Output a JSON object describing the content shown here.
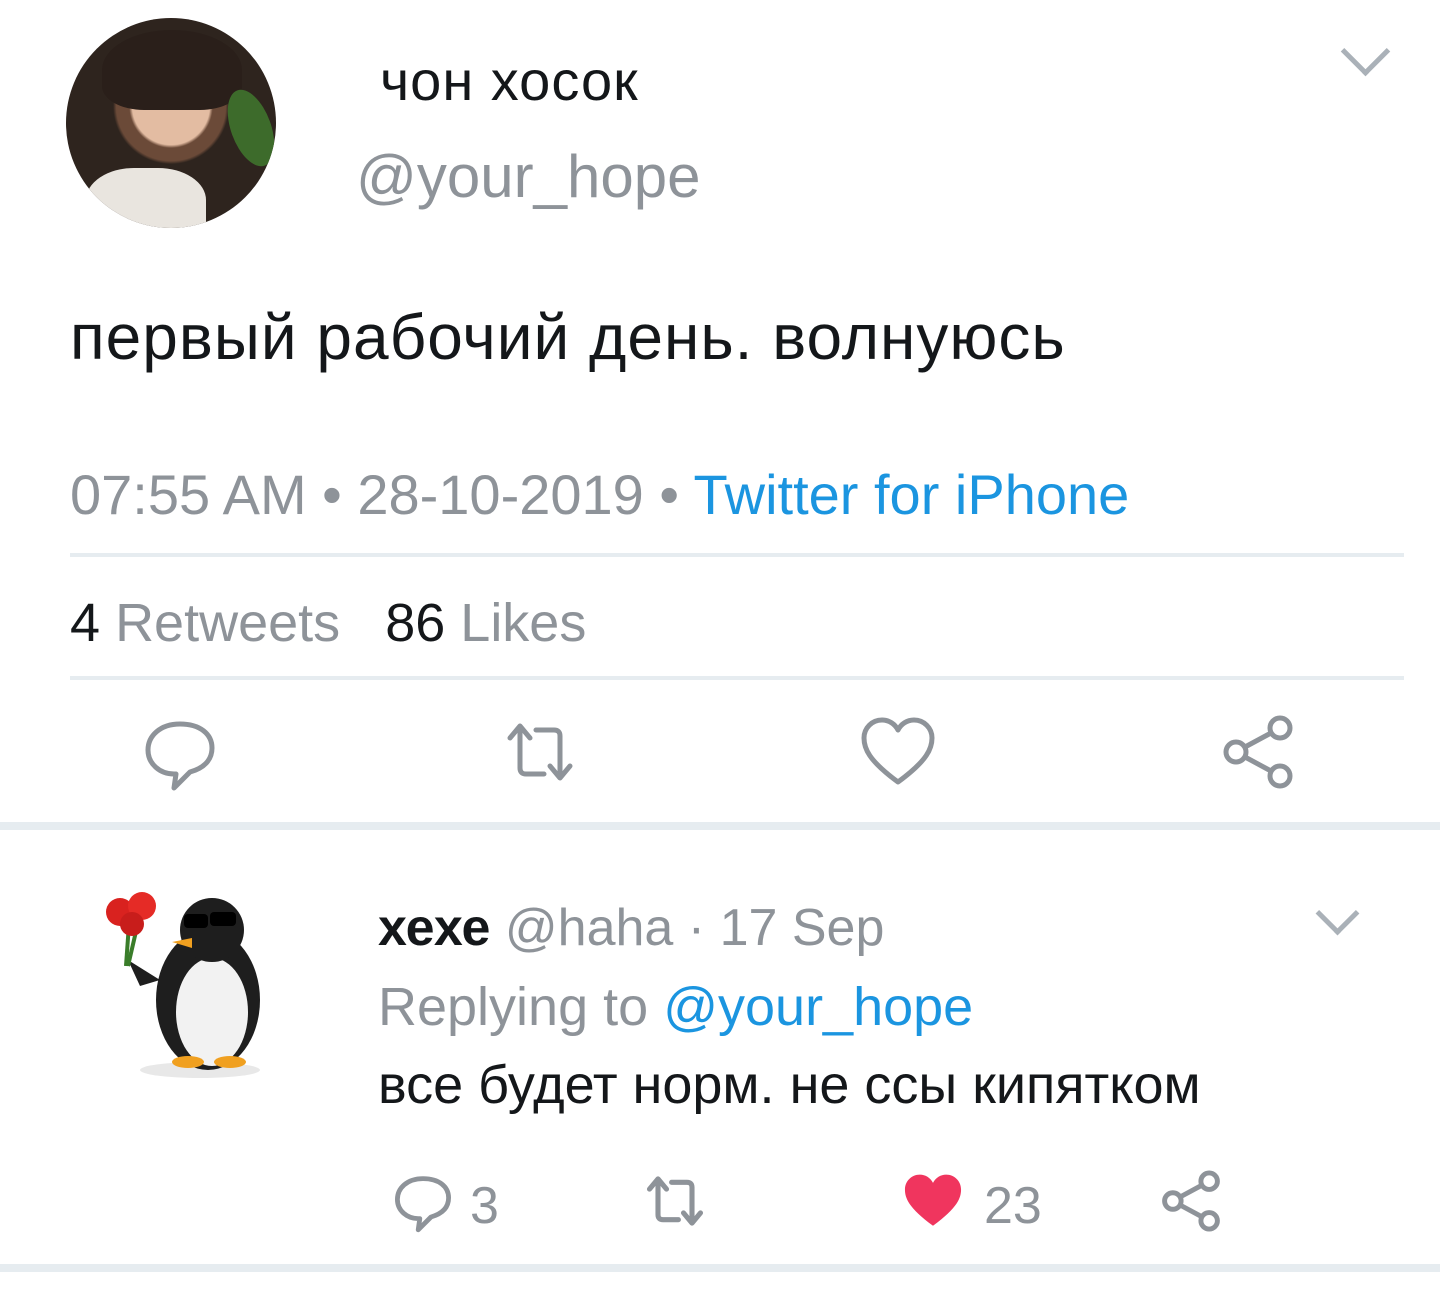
{
  "main_tweet": {
    "display_name": "чон хосок",
    "handle": "@your_hope",
    "text": "первый рабочий день. волнуюсь",
    "time": "07:55 AM",
    "separator": "•",
    "date": "28-10-2019",
    "source": "Twitter for iPhone",
    "retweets_count": "4",
    "retweets_label": "Retweets",
    "likes_count": "86",
    "likes_label": "Likes",
    "icons": [
      "reply-icon",
      "retweet-icon",
      "like-icon",
      "share-icon"
    ]
  },
  "reply": {
    "display_name": "хехе",
    "handle": "@haha",
    "separator": "·",
    "date": "17 Sep",
    "replying_prefix": "Replying to",
    "replying_to": "@your_hope",
    "text": "все будет норм. не ссы кипятком",
    "reply_count": "3",
    "likes_count": "23",
    "liked": true,
    "like_color": "#f0355e"
  },
  "colors": {
    "link": "#1b95e0",
    "muted": "#8e9399",
    "text": "#14171a",
    "divider": "#e6ecf0"
  }
}
